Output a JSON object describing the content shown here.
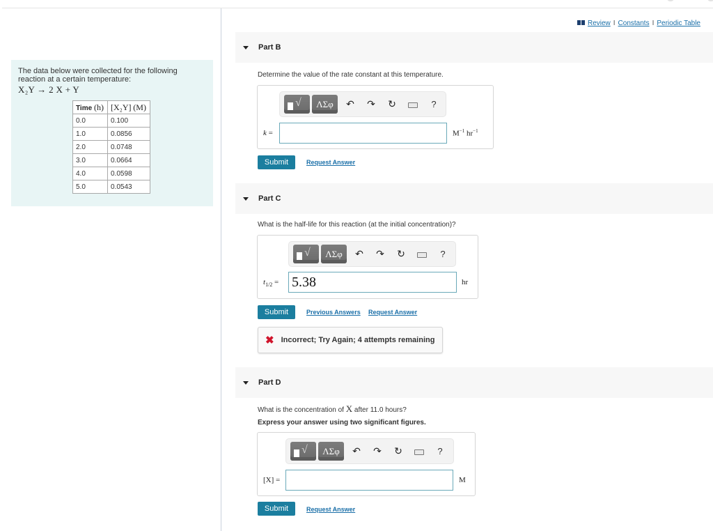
{
  "left_panel": {
    "intro": "The data below were collected for the following reaction at a certain temperature:",
    "reaction": "X₂Y → 2 X + Y",
    "table": {
      "headers": [
        {
          "label": "Time",
          "unit": "(h)"
        },
        {
          "label": "[X₂Y]",
          "unit": "(M)"
        }
      ],
      "rows": [
        [
          "0.0",
          "0.100"
        ],
        [
          "1.0",
          "0.0856"
        ],
        [
          "2.0",
          "0.0748"
        ],
        [
          "3.0",
          "0.0664"
        ],
        [
          "4.0",
          "0.0598"
        ],
        [
          "5.0",
          "0.0543"
        ]
      ]
    }
  },
  "top_links": {
    "review": "Review",
    "constants": "Constants",
    "periodic_table": "Periodic Table",
    "separator": "I"
  },
  "toolbar": {
    "template_icon": "templates-icon",
    "greek_label": "ΛΣφ",
    "undo_icon": "↶",
    "redo_icon": "↷",
    "reset_icon": "↻",
    "keyboard_icon": "keyboard-icon",
    "help_label": "?"
  },
  "parts": [
    {
      "title": "Part B",
      "question": "Determine the value of the rate constant at this temperature.",
      "variable": "k",
      "equals": "=",
      "input_value": "",
      "unit_main": "M",
      "unit_exp1": "−1",
      "unit_second": "hr",
      "unit_exp2": "−1",
      "submit_label": "Submit",
      "request_answer_label": "Request Answer"
    },
    {
      "title": "Part C",
      "question": "What is the half-life for this reaction (at the initial concentration)?",
      "variable": "t",
      "variable_sub": "1/2",
      "equals": "=",
      "input_value": "5.38",
      "unit": "hr",
      "submit_label": "Submit",
      "previous_answers_label": "Previous Answers",
      "request_answer_label": "Request Answer",
      "feedback": {
        "status": "incorrect",
        "text": "Incorrect; Try Again; 4 attempts remaining",
        "color": "#d0142b"
      }
    },
    {
      "title": "Part D",
      "question_pre": "What is the concentration of",
      "question_var": "X",
      "question_post": "after 11.0 hours?",
      "instruction": "Express your answer using two significant figures.",
      "variable": "[X]",
      "equals": "=",
      "input_value": "",
      "unit": "M",
      "submit_label": "Submit",
      "request_answer_label": "Request Answer"
    }
  ],
  "colors": {
    "accent": "#1b7e9f",
    "link": "#1a6fa8",
    "left_panel_bg": "#e8f5f5",
    "part_header_bg": "#f7f7f7",
    "error": "#d0142b"
  }
}
